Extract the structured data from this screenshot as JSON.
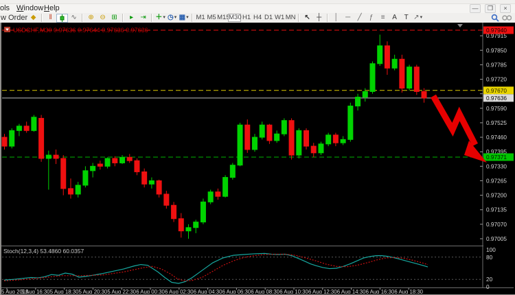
{
  "window": {
    "menu": [
      "ols",
      "Window",
      "Help"
    ],
    "controls": {
      "minimize": "—",
      "restore": "❒",
      "close": "×"
    }
  },
  "toolbar": {
    "new_order_label": "w Order",
    "letters": {
      "text_tool": "A",
      "label_tool": "T"
    },
    "timeframes": [
      "M1",
      "M5",
      "M15",
      "M30",
      "H1",
      "H4",
      "D1",
      "W1",
      "MN"
    ],
    "active_timeframe": "M30"
  },
  "chart_data": [
    {
      "type": "candlestick",
      "title_symbol": "USDCHF,M30",
      "title_ohlc": "0.97636 0.97644 0.97636 0.97636",
      "colors": {
        "up": "#00d300",
        "down": "#ef1010",
        "axis_text": "#d4d4d4",
        "background": "#000000",
        "title": "#c40000"
      },
      "y_axis": {
        "labels": [
          0.97915,
          0.9785,
          0.97785,
          0.9772,
          0.97655,
          0.9759,
          0.97525,
          0.9746,
          0.97395,
          0.9733,
          0.97265,
          0.972,
          0.97135,
          0.9707,
          0.97005
        ],
        "ylim": [
          0.96975,
          0.97968
        ]
      },
      "x_axis": {
        "labels": [
          "5 Aug 2019",
          "5 Aug 16:30",
          "5 Aug 18:30",
          "5 Aug 20:30",
          "5 Aug 22:30",
          "6 Aug 00:30",
          "6 Aug 02:30",
          "6 Aug 04:30",
          "6 Aug 06:30",
          "6 Aug 08:30",
          "6 Aug 10:30",
          "6 Aug 12:30",
          "6 Aug 14:30",
          "6 Aug 16:30",
          "6 Aug 18:30"
        ]
      },
      "levels": [
        {
          "name": "resistance-line",
          "price": 0.9794,
          "tag": "0.97940",
          "style": "dashed",
          "color": "#ee1111",
          "tag_bg": "#ee1111",
          "tag_fg": "#1a0000"
        },
        {
          "name": "upper-level-line",
          "price": 0.9767,
          "tag": "0.97670",
          "style": "dashed",
          "color": "#ddc900",
          "tag_bg": "#e8d400",
          "tag_fg": "#1a1a00"
        },
        {
          "name": "current-price-line",
          "price": 0.97636,
          "tag": "0.97636",
          "style": "solid",
          "color": "#bbbbbb",
          "tag_bg": "#dcdcdc",
          "tag_fg": "#000000"
        },
        {
          "name": "support-line",
          "price": 0.97371,
          "tag": "0.97371",
          "style": "dashed",
          "color": "#00b300",
          "tag_bg": "#00c400",
          "tag_fg": "#001a00"
        }
      ],
      "candles": [
        [
          0.9746,
          0.97475,
          0.97405,
          0.9742
        ],
        [
          0.9742,
          0.975,
          0.9741,
          0.9749
        ],
        [
          0.9749,
          0.9752,
          0.97465,
          0.9751
        ],
        [
          0.9751,
          0.9753,
          0.9748,
          0.9749
        ],
        [
          0.9749,
          0.9756,
          0.97485,
          0.9755
        ],
        [
          0.97545,
          0.9756,
          0.9735,
          0.97365
        ],
        [
          0.97365,
          0.974,
          0.97225,
          0.9738
        ],
        [
          0.9738,
          0.97405,
          0.9734,
          0.97365
        ],
        [
          0.97365,
          0.9738,
          0.972,
          0.9723
        ],
        [
          0.9723,
          0.97275,
          0.97185,
          0.97205
        ],
        [
          0.97205,
          0.9726,
          0.9719,
          0.97245
        ],
        [
          0.97245,
          0.9733,
          0.97235,
          0.9731
        ],
        [
          0.9731,
          0.97345,
          0.9728,
          0.9733
        ],
        [
          0.9734,
          0.97355,
          0.97315,
          0.9733
        ],
        [
          0.9733,
          0.9737,
          0.9732,
          0.97365
        ],
        [
          0.97365,
          0.97375,
          0.9733,
          0.97345
        ],
        [
          0.97345,
          0.9738,
          0.9734,
          0.9737
        ],
        [
          0.9737,
          0.97385,
          0.97345,
          0.97355
        ],
        [
          0.97355,
          0.97365,
          0.9729,
          0.97305
        ],
        [
          0.97305,
          0.9732,
          0.97235,
          0.9725
        ],
        [
          0.9725,
          0.9728,
          0.9723,
          0.97265
        ],
        [
          0.97265,
          0.9727,
          0.9719,
          0.97205
        ],
        [
          0.97205,
          0.9722,
          0.9714,
          0.97155
        ],
        [
          0.97155,
          0.9717,
          0.9708,
          0.97095
        ],
        [
          0.97095,
          0.9712,
          0.9701,
          0.9704
        ],
        [
          0.9704,
          0.9707,
          0.97005,
          0.97055
        ],
        [
          0.97055,
          0.9709,
          0.9703,
          0.9708
        ],
        [
          0.9708,
          0.97185,
          0.9707,
          0.9717
        ],
        [
          0.9717,
          0.97225,
          0.9716,
          0.97215
        ],
        [
          0.97215,
          0.9723,
          0.9718,
          0.97195
        ],
        [
          0.97195,
          0.9729,
          0.9719,
          0.9728
        ],
        [
          0.9728,
          0.97345,
          0.9727,
          0.97335
        ],
        [
          0.97335,
          0.97525,
          0.9733,
          0.97515
        ],
        [
          0.97515,
          0.9754,
          0.9739,
          0.97405
        ],
        [
          0.97405,
          0.97475,
          0.97395,
          0.9746
        ],
        [
          0.9746,
          0.9753,
          0.9745,
          0.97515
        ],
        [
          0.97515,
          0.9752,
          0.9743,
          0.97445
        ],
        [
          0.97445,
          0.9749,
          0.97435,
          0.97475
        ],
        [
          0.97475,
          0.97545,
          0.97465,
          0.97535
        ],
        [
          0.97535,
          0.97545,
          0.9736,
          0.9738
        ],
        [
          0.9738,
          0.975,
          0.97365,
          0.9749
        ],
        [
          0.9749,
          0.975,
          0.97405,
          0.9742
        ],
        [
          0.9742,
          0.97435,
          0.9737,
          0.9739
        ],
        [
          0.9739,
          0.9744,
          0.9738,
          0.9743
        ],
        [
          0.9743,
          0.9748,
          0.9742,
          0.9747
        ],
        [
          0.9747,
          0.9748,
          0.9742,
          0.97435
        ],
        [
          0.97435,
          0.97465,
          0.97425,
          0.9745
        ],
        [
          0.9745,
          0.97615,
          0.9744,
          0.976
        ],
        [
          0.976,
          0.97655,
          0.9758,
          0.9764
        ],
        [
          0.9764,
          0.9768,
          0.9762,
          0.97665
        ],
        [
          0.97665,
          0.978,
          0.97655,
          0.9779
        ],
        [
          0.9779,
          0.9792,
          0.9778,
          0.9787
        ],
        [
          0.9787,
          0.9789,
          0.9774,
          0.9777
        ],
        [
          0.9777,
          0.9783,
          0.9776,
          0.9781
        ],
        [
          0.9781,
          0.9783,
          0.9766,
          0.9768
        ],
        [
          0.9768,
          0.97785,
          0.9767,
          0.97775
        ],
        [
          0.97775,
          0.97785,
          0.9765,
          0.97665
        ],
        [
          0.97665,
          0.9768,
          0.97615,
          0.97636
        ]
      ],
      "annotation_arrow": {
        "color": "#e60000",
        "points": [
          [
            631,
            141
          ],
          [
            659,
            190
          ],
          [
            669,
            167
          ],
          [
            692,
            212
          ]
        ],
        "head": [
          [
            683,
            206
          ],
          [
            709,
            238
          ],
          [
            676,
            227
          ]
        ]
      }
    },
    {
      "type": "line",
      "name": "stochastic",
      "label": "Stoch(12,3,4) 53.4860 60.0357",
      "ylim": [
        0,
        100
      ],
      "level_lines": [
        80,
        20
      ],
      "scale_labels": [
        100,
        80,
        20,
        0
      ],
      "series": [
        {
          "name": "%K",
          "color": "#17a8a0",
          "style": "solid",
          "points": [
            [
              6,
              18
            ],
            [
              20,
              20
            ],
            [
              35,
              23
            ],
            [
              45,
              25
            ],
            [
              55,
              24
            ],
            [
              65,
              27
            ],
            [
              75,
              33
            ],
            [
              85,
              31
            ],
            [
              95,
              37
            ],
            [
              105,
              34
            ],
            [
              115,
              26
            ],
            [
              125,
              28
            ],
            [
              135,
              31
            ],
            [
              150,
              36
            ],
            [
              165,
              42
            ],
            [
              180,
              48
            ],
            [
              195,
              56
            ],
            [
              205,
              60
            ],
            [
              215,
              58
            ],
            [
              230,
              40
            ],
            [
              240,
              25
            ],
            [
              250,
              12
            ],
            [
              260,
              9
            ],
            [
              270,
              14
            ],
            [
              280,
              25
            ],
            [
              295,
              45
            ],
            [
              310,
              65
            ],
            [
              325,
              78
            ],
            [
              340,
              85
            ],
            [
              355,
              87
            ],
            [
              370,
              89
            ],
            [
              385,
              90
            ],
            [
              395,
              88
            ],
            [
              405,
              87
            ],
            [
              415,
              88
            ],
            [
              425,
              84
            ],
            [
              435,
              76
            ],
            [
              445,
              68
            ],
            [
              452,
              62
            ],
            [
              460,
              57
            ],
            [
              470,
              52
            ],
            [
              480,
              49
            ],
            [
              490,
              50
            ],
            [
              500,
              55
            ],
            [
              510,
              62
            ],
            [
              520,
              70
            ],
            [
              530,
              78
            ],
            [
              540,
              82
            ],
            [
              548,
              84
            ],
            [
              556,
              84
            ],
            [
              565,
              82
            ],
            [
              575,
              78
            ],
            [
              585,
              73
            ],
            [
              595,
              68
            ],
            [
              605,
              63
            ],
            [
              615,
              58
            ],
            [
              623,
              53.5
            ]
          ]
        },
        {
          "name": "%D",
          "color": "#cc1111",
          "style": "dotted",
          "points": [
            [
              6,
              16
            ],
            [
              30,
              19
            ],
            [
              60,
              24
            ],
            [
              90,
              30
            ],
            [
              120,
              30
            ],
            [
              150,
              32
            ],
            [
              180,
              40
            ],
            [
              210,
              52
            ],
            [
              222,
              55
            ],
            [
              235,
              48
            ],
            [
              248,
              35
            ],
            [
              258,
              22
            ],
            [
              268,
              16
            ],
            [
              280,
              17
            ],
            [
              295,
              26
            ],
            [
              310,
              42
            ],
            [
              325,
              58
            ],
            [
              340,
              70
            ],
            [
              355,
              79
            ],
            [
              370,
              84
            ],
            [
              385,
              87
            ],
            [
              400,
              88
            ],
            [
              415,
              88
            ],
            [
              430,
              85
            ],
            [
              445,
              78
            ],
            [
              460,
              70
            ],
            [
              475,
              61
            ],
            [
              490,
              55
            ],
            [
              505,
              54
            ],
            [
              520,
              58
            ],
            [
              535,
              65
            ],
            [
              550,
              73
            ],
            [
              562,
              78
            ],
            [
              575,
              79
            ],
            [
              588,
              77
            ],
            [
              600,
              72
            ],
            [
              612,
              66
            ],
            [
              623,
              60
            ]
          ]
        }
      ]
    }
  ]
}
